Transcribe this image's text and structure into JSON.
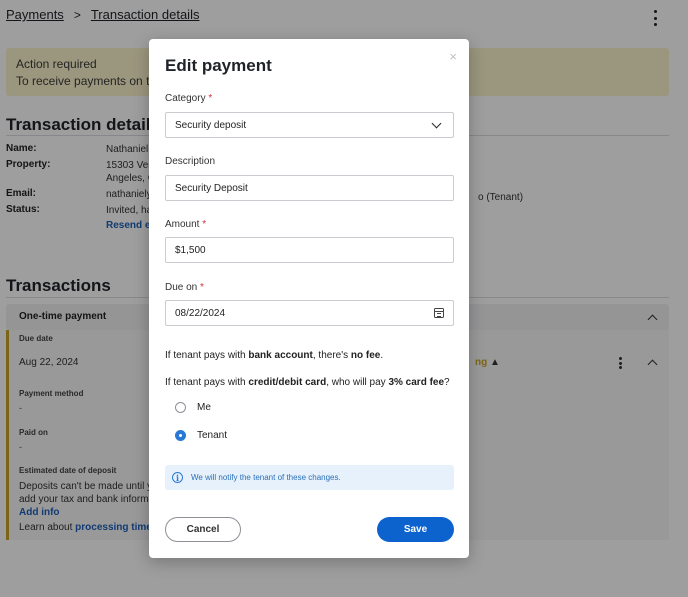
{
  "breadcrumb": {
    "root": "Payments",
    "separator": ">",
    "current": "Transaction details"
  },
  "alert": {
    "title": "Action required",
    "text": "To receive payments on tim"
  },
  "details": {
    "heading": "Transaction details",
    "name_label": "Name:",
    "name_value": "Nathaniel",
    "property_label": "Property:",
    "property_value_1": "15303 Ver",
    "property_value_2": "Angeles, C",
    "email_label": "Email:",
    "email_value": "nathaniely",
    "email_extra": "o (Tenant)",
    "status_label": "Status:",
    "status_value": "Invited, ha",
    "resend_link": "Resend er"
  },
  "transactions": {
    "heading": "Transactions",
    "group_label": "One-time payment",
    "due_date_label": "Due date",
    "due_date_value": "Aug 22, 2024",
    "status_partial": "ng",
    "payment_method_label": "Payment method",
    "payment_method_value": "-",
    "paid_on_label": "Paid on",
    "paid_on_value": "-",
    "deposit_label": "Estimated date of deposit",
    "deposit_text_1": "Deposits can't be made until yo",
    "deposit_text_2": "add your tax and bank informa",
    "add_info_link": "Add info",
    "learn_prefix": "Learn about ",
    "learn_link": "processing times."
  },
  "modal": {
    "title": "Edit payment",
    "close_glyph": "×",
    "category": {
      "label": "Category",
      "required_mark": "*",
      "value": "Security deposit"
    },
    "description": {
      "label": "Description",
      "value": "Security Deposit"
    },
    "amount": {
      "label": "Amount",
      "required_mark": "*",
      "value": "$1,500"
    },
    "due_on": {
      "label": "Due on",
      "required_mark": "*",
      "value": "08/22/2024"
    },
    "bank_note": {
      "prefix": "If tenant pays with ",
      "bold1": "bank account",
      "middle": ", there's ",
      "bold2": "no fee",
      "suffix": "."
    },
    "card_note": {
      "prefix": "If tenant pays with ",
      "bold1": "credit/debit card",
      "middle": ", who will pay ",
      "bold2": "3% card fee",
      "suffix": "?"
    },
    "options": [
      {
        "label": "Me",
        "selected": false
      },
      {
        "label": "Tenant",
        "selected": true
      }
    ],
    "info_text": "We will notify the tenant of these changes.",
    "info_glyph": "i",
    "cancel_label": "Cancel",
    "save_label": "Save"
  },
  "colors": {
    "accent": "#0c63ce",
    "alert_bg": "#fbf3cc",
    "required": "#d2323a",
    "info_bg": "#e6f1fb"
  }
}
